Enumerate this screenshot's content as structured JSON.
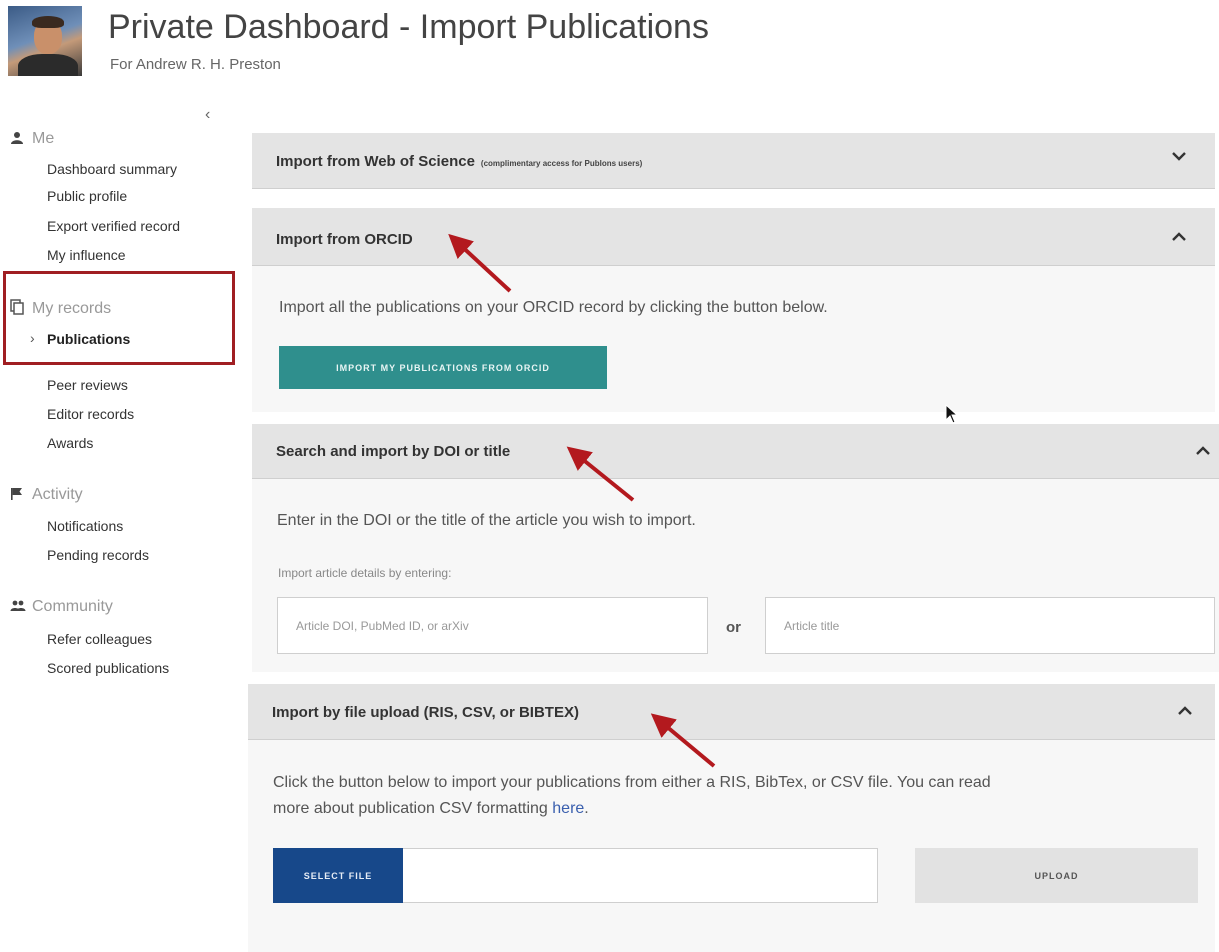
{
  "header": {
    "title": "Private Dashboard - Import Publications",
    "subtitle": "For Andrew R. H. Preston"
  },
  "sidebar": {
    "collapse_glyph": "‹",
    "sections": [
      {
        "label": "Me",
        "icon": "person-icon",
        "items": [
          "Dashboard summary",
          "Public profile",
          "Export verified record",
          "My influence"
        ]
      },
      {
        "label": "My records",
        "icon": "copy-icon",
        "items": [
          "Publications",
          "Peer reviews",
          "Editor records",
          "Awards"
        ]
      },
      {
        "label": "Activity",
        "icon": "flag-icon",
        "items": [
          "Notifications",
          "Pending records"
        ]
      },
      {
        "label": "Community",
        "icon": "people-icon",
        "items": [
          "Refer colleagues",
          "Scored publications"
        ]
      }
    ],
    "active_item": "Publications"
  },
  "panels": {
    "wos": {
      "title": "Import from Web of Science",
      "note": "(complimentary access for Publons users)",
      "expanded": false
    },
    "orcid": {
      "title": "Import from ORCID",
      "description": "Import all the publications on your ORCID record by clicking the button below.",
      "button": "IMPORT MY PUBLICATIONS FROM ORCID",
      "expanded": true
    },
    "doi": {
      "title": "Search and import by DOI or title",
      "description": "Enter in the DOI or the title of the article you wish to import.",
      "hint": "Import article details by entering:",
      "doi_placeholder": "Article DOI, PubMed ID, or arXiv",
      "or": "or",
      "title_placeholder": "Article title",
      "expanded": true
    },
    "file": {
      "title": "Import by file upload (RIS, CSV, or BIBTEX)",
      "description_line1": "Click the button below to import your publications from either a RIS, BibTex, or CSV file. You can read",
      "description_line2": "more about publication CSV formatting",
      "link": "here",
      "select_button": "SELECT FILE",
      "upload_button": "UPLOAD",
      "expanded": true
    }
  },
  "colors": {
    "teal_button": "#2f8f8d",
    "blue_button": "#17488a",
    "highlight_box": "#a01e22",
    "annotation_arrow": "#b3191e"
  }
}
